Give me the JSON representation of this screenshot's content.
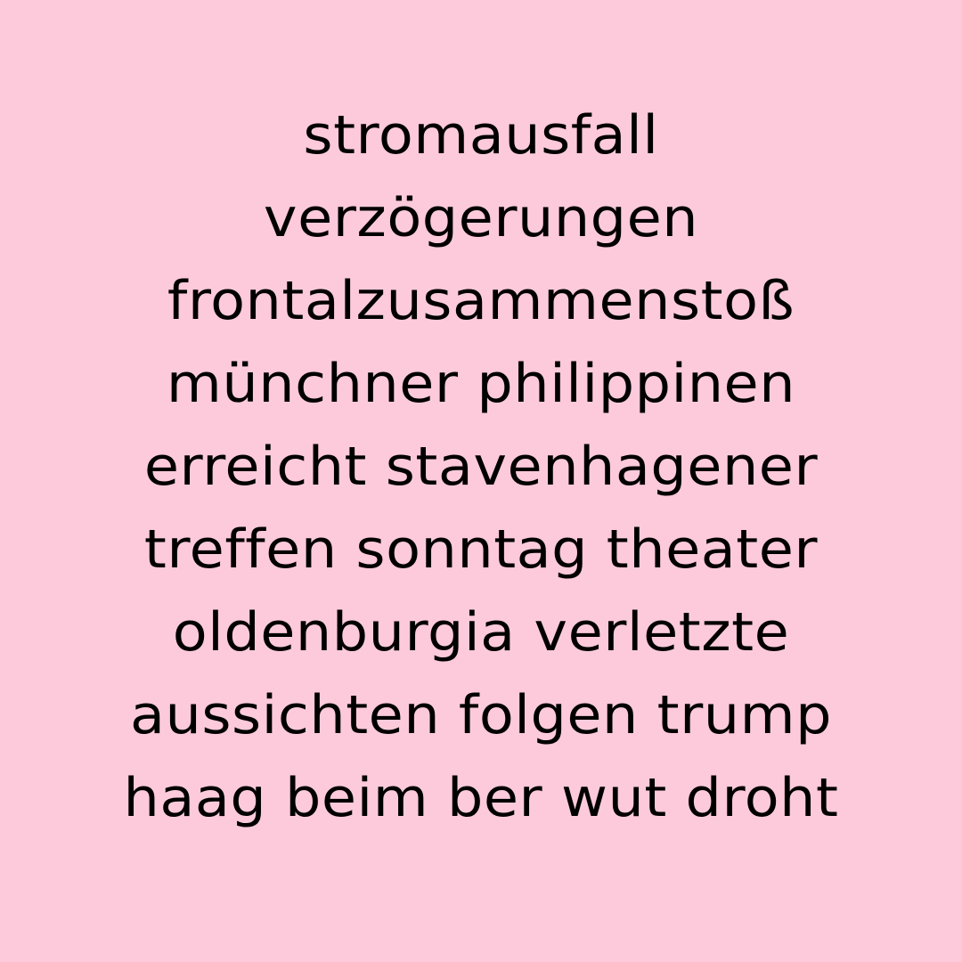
{
  "background_color": "#FCCADB",
  "text_color": "#000000",
  "lines": [
    "stromausfall",
    "verzögerungen",
    "frontalzusammenstoß",
    "münchner philippinen",
    "erreicht stavenhagener",
    "treffen sonntag theater",
    "oldenburgia verletzte",
    "aussichten folgen trump",
    "haag beim ber wut droht"
  ]
}
